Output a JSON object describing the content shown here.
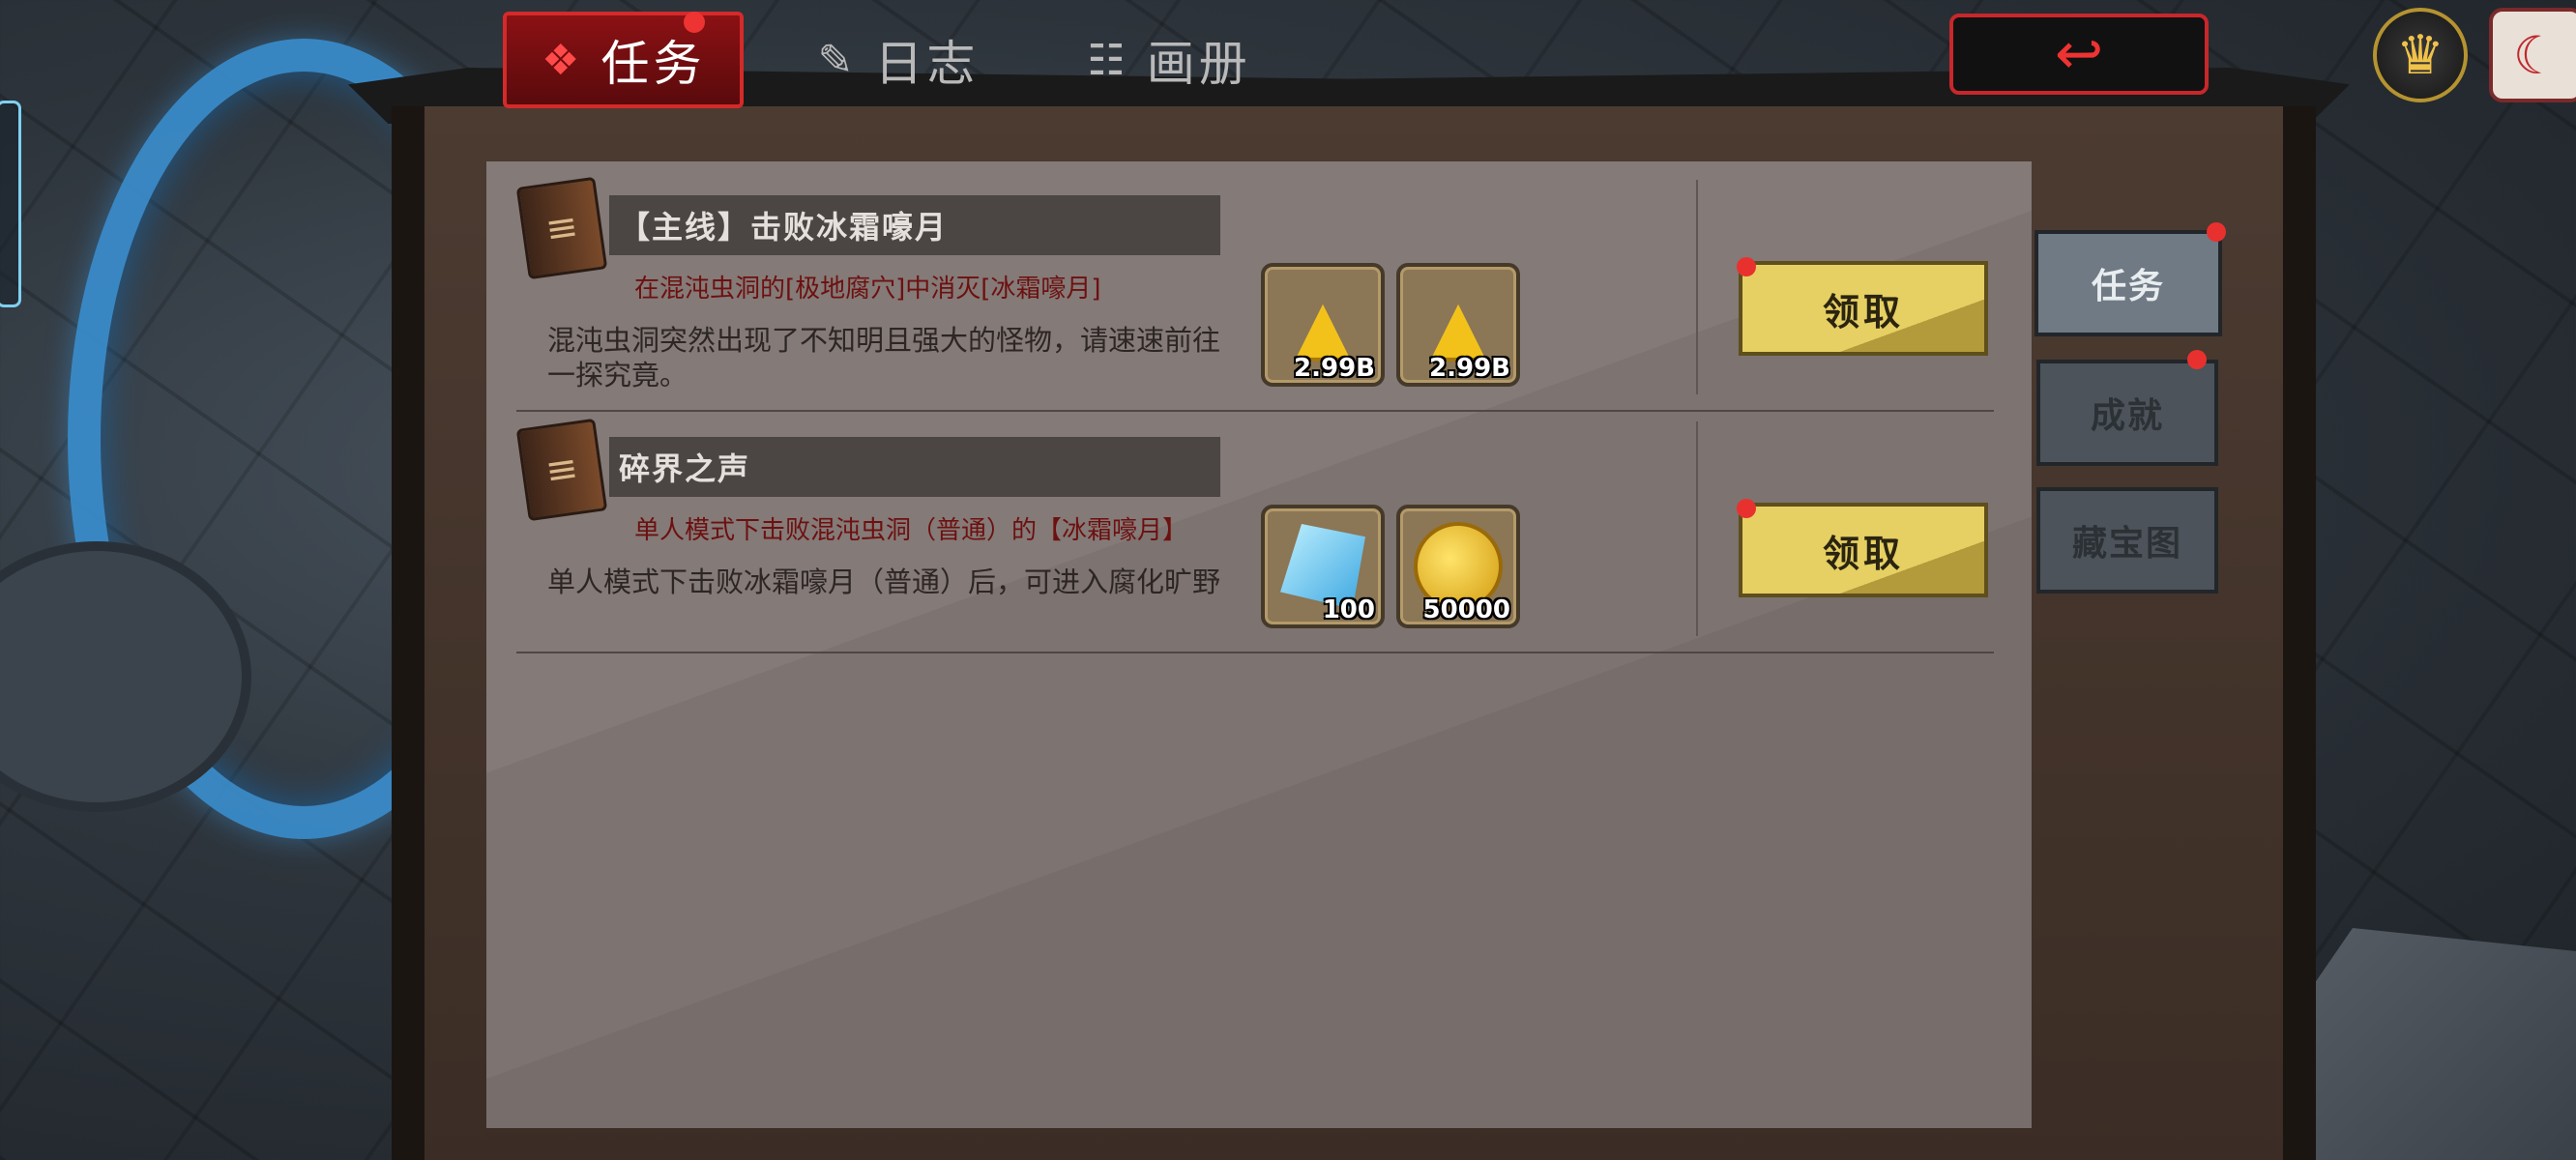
{
  "tabs": [
    {
      "label": "任务",
      "icon": "scroll-icon",
      "active": true,
      "badge": true
    },
    {
      "label": "日志",
      "icon": "quill-icon",
      "active": false,
      "badge": false
    },
    {
      "label": "画册",
      "icon": "album-icon",
      "active": false,
      "badge": false
    }
  ],
  "top_right": {
    "back_icon": "back-arrow-icon",
    "crown_icon": "crown-gem-icon",
    "calendar_icon": "calendar-moon-icon"
  },
  "quests": [
    {
      "title": "【主线】击败冰霜嚎月",
      "objective": "在混沌虫洞的[极地腐穴]中消灭[冰霜嚎月]",
      "description": "混沌虫洞突然出现了不知明且强大的怪物，请速速前往一探究竟。",
      "rewards": [
        {
          "type": "gold-rank",
          "qty": "2.99B"
        },
        {
          "type": "gold-rank",
          "qty": "2.99B"
        }
      ],
      "claim_label": "领取"
    },
    {
      "title": "碎界之声",
      "objective": "单人模式下击败混沌虫洞（普通）的【冰霜嚎月】",
      "description": "单人模式下击败冰霜嚎月（普通）后，可进入腐化旷野",
      "rewards": [
        {
          "type": "crystal",
          "qty": "100"
        },
        {
          "type": "coin",
          "qty": "50000"
        }
      ],
      "claim_label": "领取"
    }
  ],
  "side_tabs": [
    {
      "label": "任务",
      "active": true,
      "badge": true
    },
    {
      "label": "成就",
      "active": false,
      "badge": true
    },
    {
      "label": "藏宝图",
      "active": false,
      "badge": false
    }
  ],
  "colors": {
    "active_tab": "#8b1114",
    "claim_button": "#e6cf63",
    "badge": "#e8312f",
    "panel": "#7d7370"
  }
}
